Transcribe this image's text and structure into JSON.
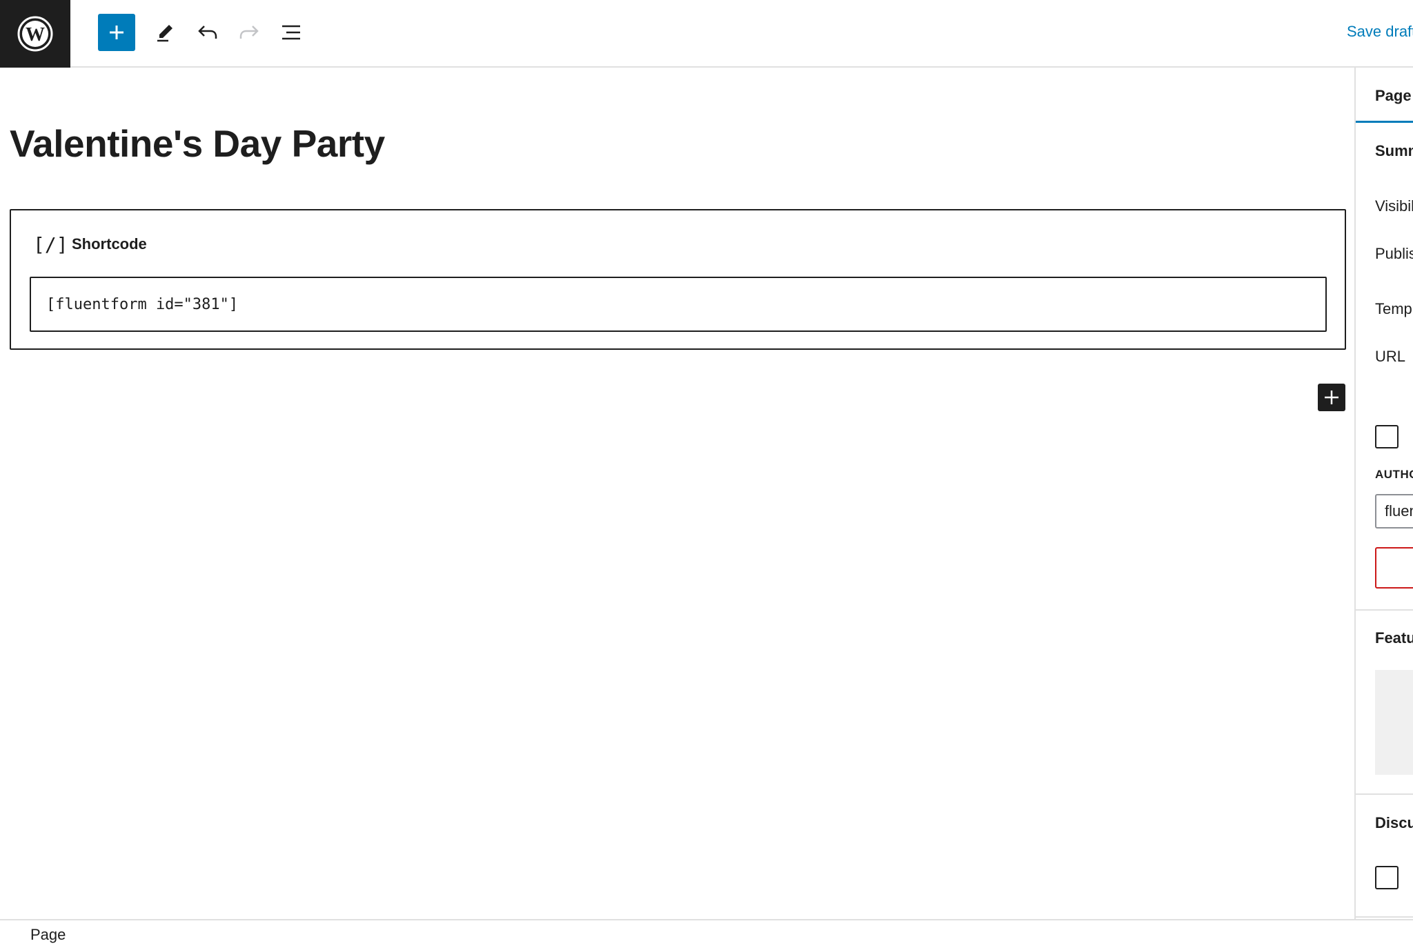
{
  "toolbar": {
    "logo_icon": "wordpress-logo-icon",
    "add_block_icon": "plus-icon",
    "tools_icon": "pencil-icon",
    "undo_icon": "undo-icon",
    "redo_icon": "redo-icon",
    "outline_icon": "list-view-icon",
    "save_draft_label": "Save draft",
    "accent_color": "#007cba"
  },
  "editor": {
    "title": "Valentine's Day Party",
    "block": {
      "icon_text": "[/]",
      "label": "Shortcode",
      "value": "[fluentform id=\"381\"]"
    },
    "inserter_icon": "plus-icon"
  },
  "sidebar": {
    "tab_label": "Page",
    "summary_label": "Summary",
    "visibility_label": "Visibility",
    "publish_label": "Publish",
    "template_label": "Template",
    "url_label": "URL",
    "author_label": "AUTHOR",
    "author_value": "fluentform",
    "featured_label": "Featured image",
    "discussion_label": "Discussion"
  },
  "footer": {
    "breadcrumb": "Page"
  }
}
